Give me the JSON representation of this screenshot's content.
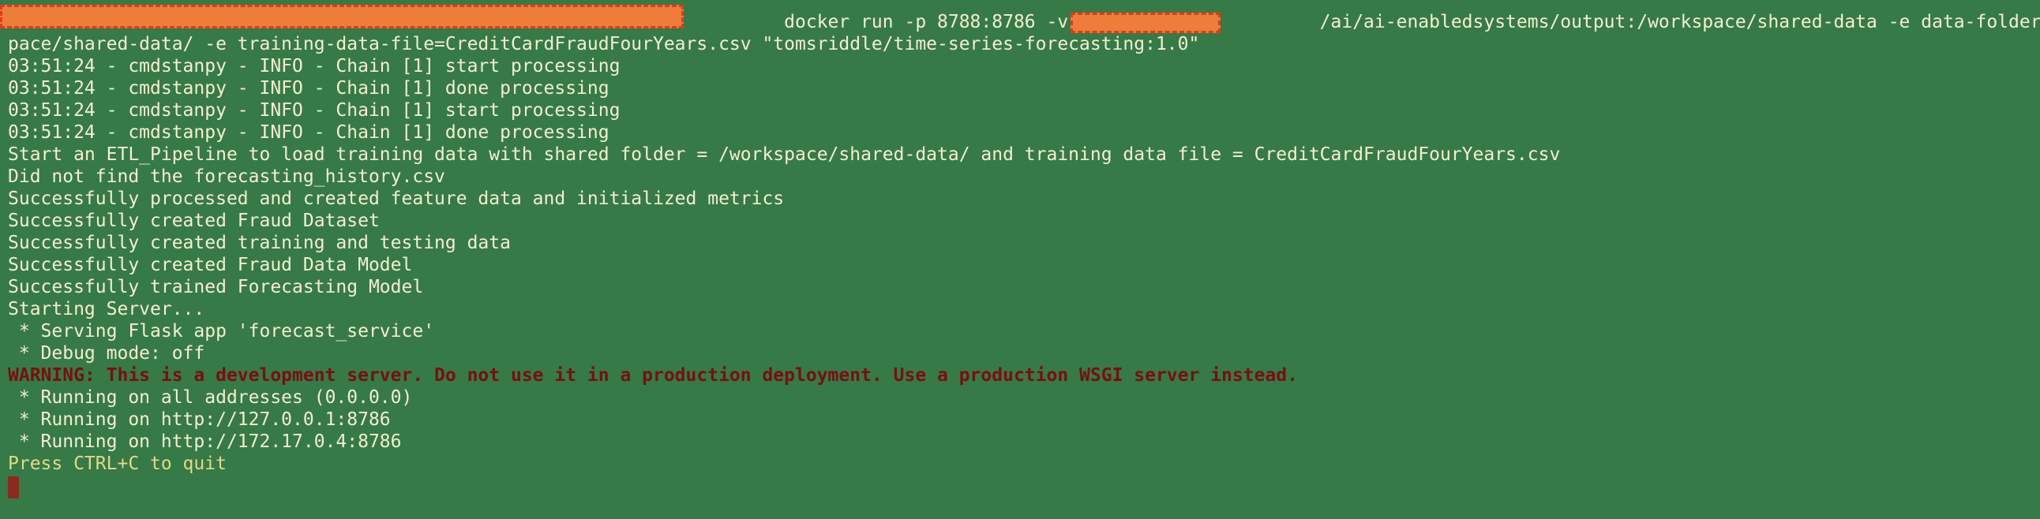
{
  "terminal": {
    "lines": [
      {
        "kind": "normal",
        "text": "                                                                       docker run -p 8788:8786 -v /Users/               /ai/ai-enabledsystems/output:/workspace/shared-data -e data-folder=/works"
      },
      {
        "kind": "normal",
        "text": "pace/shared-data/ -e training-data-file=CreditCardFraudFourYears.csv \"tomsriddle/time-series-forecasting:1.0\""
      },
      {
        "kind": "normal",
        "text": "03:51:24 - cmdstanpy - INFO - Chain [1] start processing"
      },
      {
        "kind": "normal",
        "text": "03:51:24 - cmdstanpy - INFO - Chain [1] done processing"
      },
      {
        "kind": "normal",
        "text": "03:51:24 - cmdstanpy - INFO - Chain [1] start processing"
      },
      {
        "kind": "normal",
        "text": "03:51:24 - cmdstanpy - INFO - Chain [1] done processing"
      },
      {
        "kind": "normal",
        "text": "Start an ETL_Pipeline to load training data with shared folder = /workspace/shared-data/ and training data file = CreditCardFraudFourYears.csv"
      },
      {
        "kind": "normal",
        "text": "Did not find the forecasting_history.csv"
      },
      {
        "kind": "normal",
        "text": "Successfully processed and created feature data and initialized metrics"
      },
      {
        "kind": "normal",
        "text": "Successfully created Fraud Dataset"
      },
      {
        "kind": "normal",
        "text": "Successfully created training and testing data"
      },
      {
        "kind": "normal",
        "text": "Successfully created Fraud Data Model"
      },
      {
        "kind": "normal",
        "text": "Successfully trained Forecasting Model"
      },
      {
        "kind": "normal",
        "text": "Starting Server..."
      },
      {
        "kind": "normal",
        "text": " * Serving Flask app 'forecast_service'"
      },
      {
        "kind": "normal",
        "text": " * Debug mode: off"
      },
      {
        "kind": "warning",
        "text": "WARNING: This is a development server. Do not use it in a production deployment. Use a production WSGI server instead."
      },
      {
        "kind": "normal",
        "text": " * Running on all addresses (0.0.0.0)"
      },
      {
        "kind": "normal",
        "text": " * Running on http://127.0.0.1:8786"
      },
      {
        "kind": "normal",
        "text": " * Running on http://172.17.0.4:8786"
      },
      {
        "kind": "quit",
        "text": "Press CTRL+C to quit"
      }
    ]
  },
  "colors": {
    "background": "#367a47",
    "text": "#f4eed2",
    "warning": "#7b0e0e",
    "quit": "#e3d98a",
    "redaction_fill": "#ee7d3a",
    "redaction_border": "#e23a1c",
    "cursor": "#8b2a1e"
  }
}
